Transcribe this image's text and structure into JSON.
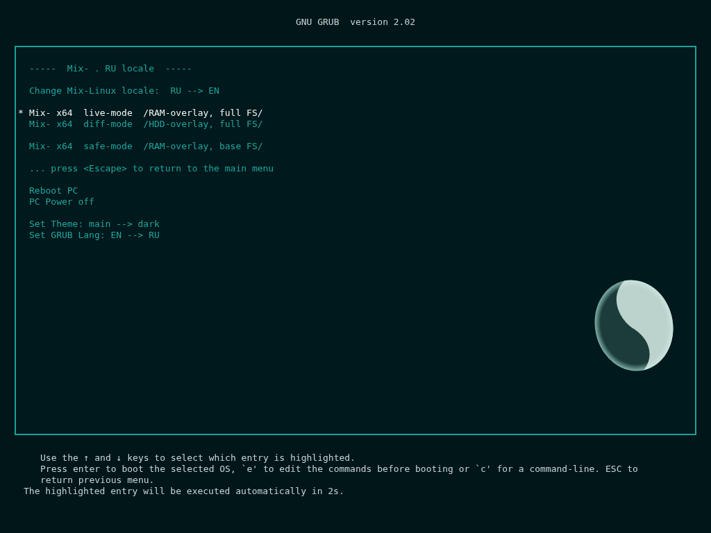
{
  "title": "GNU GRUB  version 2.02",
  "menu": {
    "selected_marker": "*",
    "groups": [
      [
        {
          "label": "-----  Mix- . RU locale  -----",
          "selected": false
        }
      ],
      [
        {
          "label": "Change Mix-Linux locale:  RU --> EN",
          "selected": false
        }
      ],
      [
        {
          "label": "Mix- x64  live-mode  /RAM-overlay, full FS/",
          "selected": true
        },
        {
          "label": "Mix- x64  diff-mode  /HDD-overlay, full FS/",
          "selected": false
        }
      ],
      [
        {
          "label": "Mix- x64  safe-mode  /RAM-overlay, base FS/",
          "selected": false
        }
      ],
      [
        {
          "label": "... press <Escape> to return to the main menu",
          "selected": false
        }
      ],
      [
        {
          "label": "Reboot PC",
          "selected": false
        },
        {
          "label": "PC Power off",
          "selected": false
        }
      ],
      [
        {
          "label": "Set Theme: main --> dark",
          "selected": false
        },
        {
          "label": "Set GRUB Lang: EN --> RU",
          "selected": false
        }
      ]
    ]
  },
  "help": [
    {
      "text": "Use the ↑ and ↓ keys to select which entry is highlighted.",
      "indented": true
    },
    {
      "text": "Press enter to boot the selected OS, `e' to edit the commands before booting or `c' for a command-line. ESC to",
      "indented": true
    },
    {
      "text": "return previous menu.",
      "indented": true
    },
    {
      "text": "The highlighted entry will be executed automatically in 2s.",
      "indented": false
    }
  ]
}
